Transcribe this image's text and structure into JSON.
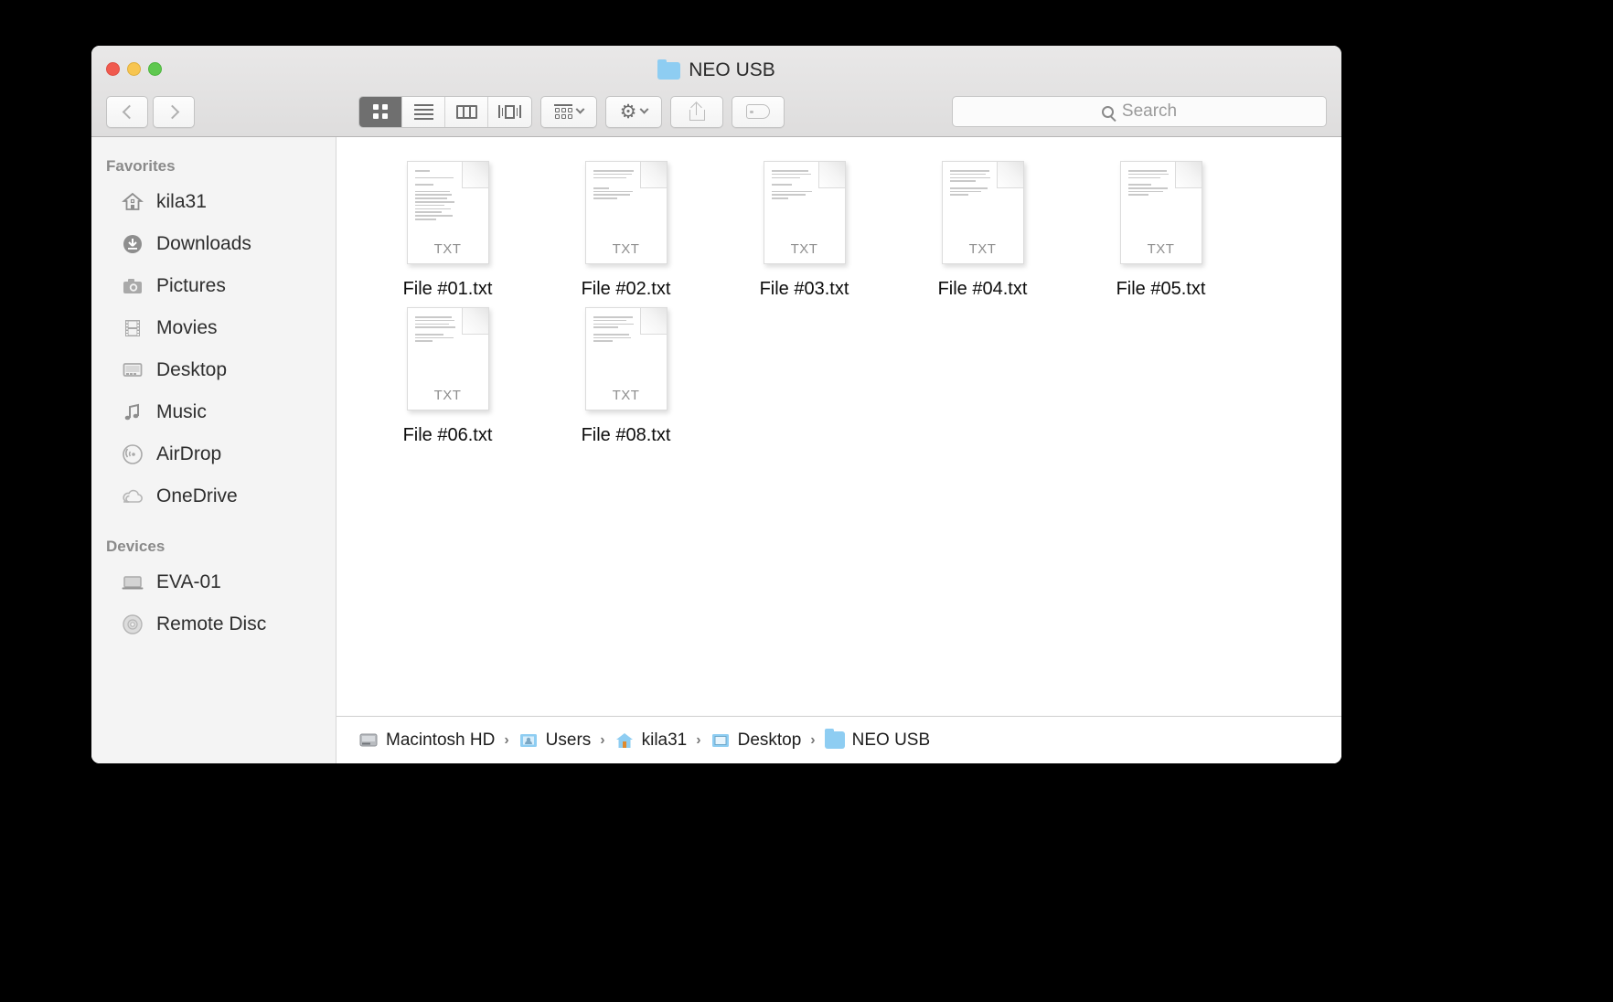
{
  "window": {
    "title": "NEO USB",
    "title_icon": "folder-icon",
    "traffic_lights": [
      "close-button",
      "minimize-button",
      "zoom-button"
    ]
  },
  "toolbar": {
    "back_label": "Back",
    "forward_label": "Forward",
    "view_modes": [
      {
        "name": "icon-view",
        "label": "Icon View",
        "active": true
      },
      {
        "name": "list-view",
        "label": "List View",
        "active": false
      },
      {
        "name": "column-view",
        "label": "Column View",
        "active": false
      },
      {
        "name": "gallery-view",
        "label": "Gallery View",
        "active": false
      }
    ],
    "arrange_label": "Arrange By",
    "action_label": "Action",
    "share_label": "Share",
    "tags_label": "Tags"
  },
  "search": {
    "placeholder": "Search",
    "value": "",
    "icon": "search-icon"
  },
  "sidebar": {
    "sections": [
      {
        "header": "Favorites",
        "items": [
          {
            "label": "kila31",
            "icon": "home-icon"
          },
          {
            "label": "Downloads",
            "icon": "download-icon"
          },
          {
            "label": "Pictures",
            "icon": "camera-icon"
          },
          {
            "label": "Movies",
            "icon": "film-icon"
          },
          {
            "label": "Desktop",
            "icon": "desktop-icon"
          },
          {
            "label": "Music",
            "icon": "music-note-icon"
          },
          {
            "label": "AirDrop",
            "icon": "airdrop-icon"
          },
          {
            "label": "OneDrive",
            "icon": "cloud-icon"
          }
        ]
      },
      {
        "header": "Devices",
        "items": [
          {
            "label": "EVA-01",
            "icon": "laptop-icon"
          },
          {
            "label": "Remote Disc",
            "icon": "disc-icon"
          }
        ]
      }
    ]
  },
  "files": [
    {
      "name": "File #01.txt",
      "ext": "TXT"
    },
    {
      "name": "File #02.txt",
      "ext": "TXT"
    },
    {
      "name": "File #03.txt",
      "ext": "TXT"
    },
    {
      "name": "File #04.txt",
      "ext": "TXT"
    },
    {
      "name": "File #05.txt",
      "ext": "TXT"
    },
    {
      "name": "File #06.txt",
      "ext": "TXT"
    },
    {
      "name": "File #08.txt",
      "ext": "TXT"
    }
  ],
  "breadcrumb": [
    {
      "label": "Macintosh HD",
      "icon": "harddisk-icon"
    },
    {
      "label": "Users",
      "icon": "users-folder-icon"
    },
    {
      "label": "kila31",
      "icon": "home-folder-icon"
    },
    {
      "label": "Desktop",
      "icon": "desktop-folder-icon"
    },
    {
      "label": "NEO USB",
      "icon": "folder-icon"
    }
  ],
  "separator": "›",
  "colors": {
    "folder_blue": "#8ecdf2",
    "active_segment": "#6f6f6f",
    "sidebar_bg": "#f4f4f4",
    "titlebar_bg": "#e4e3e3"
  }
}
